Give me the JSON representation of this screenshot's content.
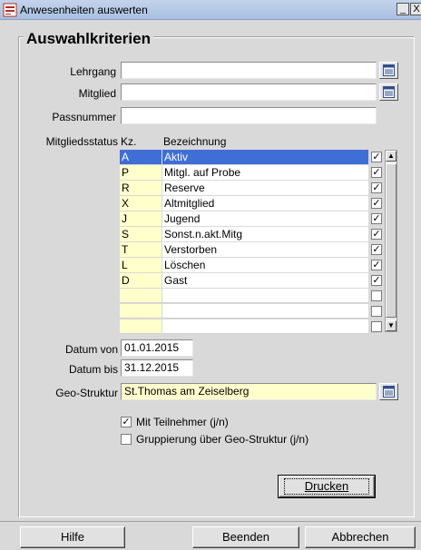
{
  "window": {
    "title": "Anwesenheiten auswerten",
    "min_glyph": "_",
    "close_glyph": "X"
  },
  "group": {
    "title": "Auswahlkriterien"
  },
  "fields": {
    "lehrgang": {
      "label": "Lehrgang",
      "value": ""
    },
    "mitglied": {
      "label": "Mitglied",
      "value": ""
    },
    "passnummer": {
      "label": "Passnummer",
      "value": ""
    },
    "datum_von": {
      "label": "Datum von",
      "value": "01.01.2015"
    },
    "datum_bis": {
      "label": "Datum bis",
      "value": "31.12.2015"
    },
    "geo_struktur": {
      "label": "Geo-Struktur",
      "value": "St.Thomas am Zeiselberg"
    }
  },
  "status_grid": {
    "label": "Mitgliedsstatus",
    "col_kz": "Kz.",
    "col_bez": "Bezeichnung",
    "rows": [
      {
        "kz": "A",
        "bez": "Aktiv",
        "checked": true,
        "selected": true
      },
      {
        "kz": "P",
        "bez": "Mitgl. auf Probe",
        "checked": true
      },
      {
        "kz": "R",
        "bez": "Reserve",
        "checked": true
      },
      {
        "kz": "X",
        "bez": "Altmitglied",
        "checked": true
      },
      {
        "kz": "J",
        "bez": "Jugend",
        "checked": true
      },
      {
        "kz": "S",
        "bez": "Sonst.n.akt.Mitg",
        "checked": true
      },
      {
        "kz": "T",
        "bez": "Verstorben",
        "checked": true
      },
      {
        "kz": "L",
        "bez": "Löschen",
        "checked": true
      },
      {
        "kz": "D",
        "bez": "Gast",
        "checked": true
      },
      {
        "kz": "",
        "bez": "",
        "checked": false
      },
      {
        "kz": "",
        "bez": "",
        "checked": false
      },
      {
        "kz": "",
        "bez": "",
        "checked": false
      }
    ]
  },
  "options": {
    "mit_teilnehmer": {
      "label": "Mit Teilnehmer (j/n)",
      "checked": true
    },
    "gruppierung": {
      "label": "Gruppierung über Geo-Struktur (j/n)",
      "checked": false
    }
  },
  "buttons": {
    "drucken": "Drucken",
    "hilfe": "Hilfe",
    "beenden": "Beenden",
    "abbrechen": "Abbrechen"
  },
  "colors": {
    "selection": "#3f6fd6",
    "readonly_yellow": "#ffffcc"
  }
}
